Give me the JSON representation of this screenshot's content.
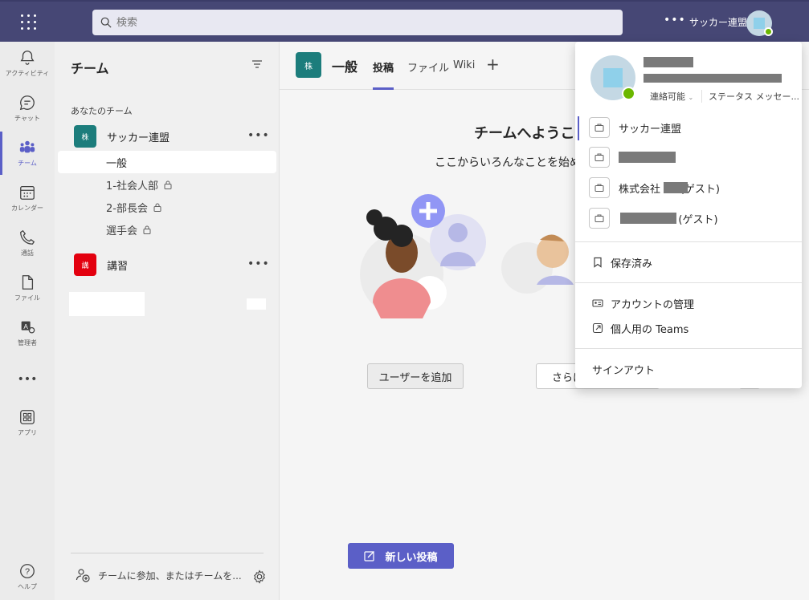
{
  "topbar": {
    "search_placeholder": "検索",
    "more": "•••",
    "org_name": "サッカー連盟"
  },
  "rail": [
    {
      "label": "アクティビティ",
      "icon": "bell-icon"
    },
    {
      "label": "チャット",
      "icon": "chat-icon"
    },
    {
      "label": "チーム",
      "icon": "teams-icon"
    },
    {
      "label": "カレンダー",
      "icon": "calendar-icon"
    },
    {
      "label": "通話",
      "icon": "phone-icon"
    },
    {
      "label": "ファイル",
      "icon": "file-icon"
    },
    {
      "label": "管理者",
      "icon": "admin-icon"
    },
    {
      "label": "•••",
      "icon": "more-icon"
    },
    {
      "label": "アプリ",
      "icon": "apps-icon"
    },
    {
      "label": "ヘルプ",
      "icon": "help-icon"
    }
  ],
  "panel": {
    "title": "チーム",
    "section_label": "あなたのチーム",
    "teams": [
      {
        "avatar": "株",
        "name": "サッカー連盟",
        "color": "#1c7d7c"
      },
      {
        "avatar": "講",
        "name": "講習",
        "color": "#e3000f"
      }
    ],
    "channels": [
      {
        "name": "一般"
      },
      {
        "name": "1-社会人部"
      },
      {
        "name": "2-部長会"
      },
      {
        "name": "選手会"
      }
    ],
    "more": "•••",
    "join_text": "チームに参加、またはチームを..."
  },
  "main": {
    "channel_avatar": "株",
    "channel_name": "一般",
    "tabs": [
      "投稿",
      "ファイル",
      "Wiki"
    ],
    "tab_add": "+",
    "welcome_title": "チームへようこそ！",
    "welcome_sub": "ここからいろんなことを始めましょう。",
    "add_user_btn": "ユーザーを追加",
    "more_btn": "さらにアプリを追加",
    "new_post_btn": "新しい投稿"
  },
  "dropdown": {
    "status": "連絡可能",
    "status_msg": "ステータス メッセー...",
    "orgs": [
      {
        "name": "サッカー連盟"
      },
      {
        "name": ""
      },
      {
        "name": "株式会社      (ゲスト)"
      },
      {
        "name": "                  (ゲスト)"
      }
    ],
    "saved": "保存済み",
    "manage_account": "アカウントの管理",
    "personal_teams": "個人用の Teams",
    "sign_out": "サインアウト"
  },
  "colors": {
    "accent": "#5b5fc7",
    "topbar": "#464775",
    "available": "#6bb700"
  }
}
